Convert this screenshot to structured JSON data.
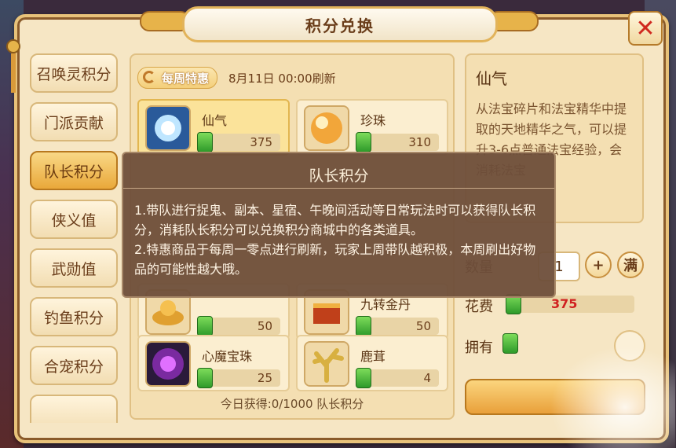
{
  "window": {
    "title": "积分兑换"
  },
  "sidebar": {
    "items": [
      {
        "label": "召唤灵积分",
        "active": false
      },
      {
        "label": "门派贡献",
        "active": false
      },
      {
        "label": "队长积分",
        "active": true
      },
      {
        "label": "侠义值",
        "active": false
      },
      {
        "label": "武勋值",
        "active": false
      },
      {
        "label": "钓鱼积分",
        "active": false
      },
      {
        "label": "合宠积分",
        "active": false
      },
      {
        "label": "",
        "active": false
      }
    ]
  },
  "shop": {
    "badge": "每周特惠",
    "refresh": "8月11日  00:00刷新",
    "items": [
      {
        "name": "仙气",
        "price": "375",
        "icon": "fairy-qi-icon"
      },
      {
        "name": "珍珠",
        "price": "310",
        "icon": "pearl-icon"
      },
      {
        "name": "",
        "price": "50",
        "icon": "gold-item-icon"
      },
      {
        "name": "九转金丹",
        "price": "50",
        "icon": "elixir-box-icon"
      },
      {
        "name": "心魔宝珠",
        "price": "25",
        "icon": "demon-orb-icon"
      },
      {
        "name": "鹿茸",
        "price": "4",
        "icon": "antler-icon"
      }
    ],
    "today": "今日获得:0/1000 队长积分"
  },
  "detail": {
    "name": "仙气",
    "desc": "从法宝碎片和法宝精华中提取的天地精华之气，可以提升3-6点普通法宝经验，会消耗法宝"
  },
  "purchase": {
    "qty_label": "数量",
    "qty": "1",
    "plus": "+",
    "max": "满",
    "cost_label": "花费",
    "cost": "375",
    "own_label": "拥有"
  },
  "tooltip": {
    "title": "队长积分",
    "body": "1.带队进行捉鬼、副本、星宿、午晚间活动等日常玩法时可以获得队长积分，消耗队长积分可以兑换积分商城中的各类道具。\n2.特惠商品于每周一零点进行刷新，玩家上周带队越积极，本周刷出好物品的可能性越大哦。"
  },
  "colors": {
    "accent": "#e9a83a",
    "panel": "#f6e6c4",
    "cost": "#d02020",
    "currency": "#2e9a2a"
  }
}
